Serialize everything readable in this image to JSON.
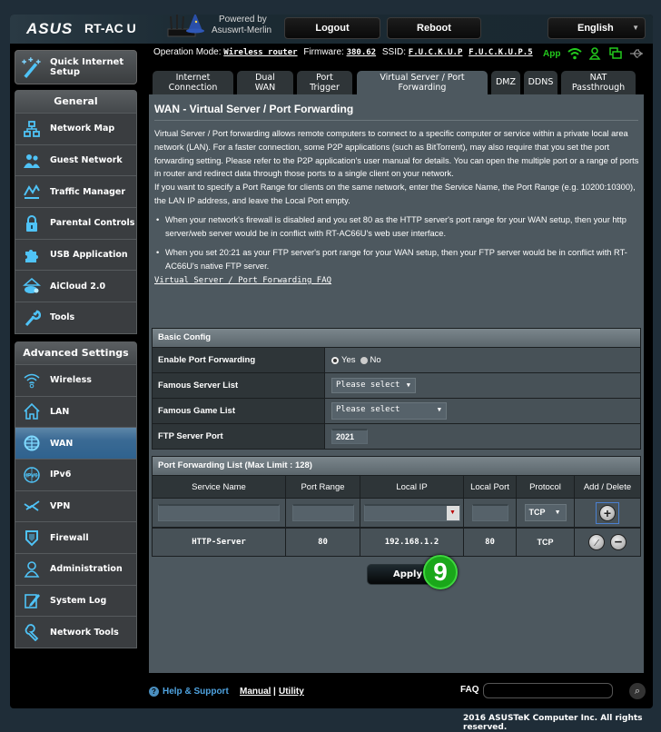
{
  "header": {
    "brand": "ASUS",
    "model": "RT-AC  U",
    "powered_by": "Powered by",
    "powered_by_name": "Asuswrt-Merlin",
    "logout_label": "Logout",
    "reboot_label": "Reboot",
    "language": "English"
  },
  "opbar": {
    "operation_mode_label": "Operation Mode:",
    "operation_mode_value": "Wireless router",
    "firmware_label": "Firmware:",
    "firmware_value": "380.62",
    "ssid_label": "SSID:",
    "ssid_24": "F.U.C.K.U.P",
    "ssid_5": "F.U.C.K.U.P.5",
    "app_label": "App"
  },
  "sidebar": {
    "quick_setup_line1": "Quick Internet",
    "quick_setup_line2": "Setup",
    "general_header": "General",
    "general_items": [
      {
        "label": "Network Map",
        "icon": "network-map-icon"
      },
      {
        "label": "Guest Network",
        "icon": "guest-network-icon"
      },
      {
        "label": "Traffic Manager",
        "icon": "traffic-manager-icon"
      },
      {
        "label": "Parental Controls",
        "icon": "lock-icon"
      },
      {
        "label": "USB Application",
        "icon": "puzzle-icon"
      },
      {
        "label": "AiCloud 2.0",
        "icon": "cloud-icon"
      },
      {
        "label": "Tools",
        "icon": "wrench-icon"
      }
    ],
    "advanced_header": "Advanced Settings",
    "advanced_items": [
      {
        "label": "Wireless",
        "icon": "wifi-icon"
      },
      {
        "label": "LAN",
        "icon": "home-icon"
      },
      {
        "label": "WAN",
        "icon": "globe-icon",
        "active": true
      },
      {
        "label": "IPv6",
        "icon": "ipv6-icon"
      },
      {
        "label": "VPN",
        "icon": "vpn-icon"
      },
      {
        "label": "Firewall",
        "icon": "shield-icon"
      },
      {
        "label": "Administration",
        "icon": "admin-user-icon"
      },
      {
        "label": "System Log",
        "icon": "log-edit-icon"
      },
      {
        "label": "Network Tools",
        "icon": "network-tools-icon"
      }
    ]
  },
  "tabs": [
    {
      "line1": "Internet",
      "line2": "Connection"
    },
    {
      "line1": "Dual",
      "line2": "WAN"
    },
    {
      "line1": "Port",
      "line2": "Trigger"
    },
    {
      "line1": "Virtual Server / Port",
      "line2": "Forwarding",
      "active": true
    },
    {
      "line1": "DMZ",
      "line2": ""
    },
    {
      "line1": "DDNS",
      "line2": ""
    },
    {
      "line1": "NAT",
      "line2": "Passthrough"
    }
  ],
  "page": {
    "title": "WAN - Virtual Server / Port Forwarding",
    "description_1": "Virtual Server / Port forwarding allows remote computers to connect to a specific computer or service within a private local area network (LAN). For a faster connection, some P2P applications (such as BitTorrent), may also require that you set the port forwarding setting. Please refer to the P2P application's user manual for details. You can open the multiple port or a range of ports in router and redirect data through those ports to a single client on your network.",
    "description_2": "If you want to specify a Port Range for clients on the same network, enter the Service Name, the Port Range (e.g. 10200:10300), the LAN IP address, and leave the Local Port empty.",
    "bullet_1": "When your network's firewall is disabled and you set 80 as the HTTP server's port range for your WAN setup, then your http server/web server would be in conflict with RT-AC66U's web user interface.",
    "bullet_2": "When you set 20:21 as your FTP server's port range for your WAN setup, then your FTP server would be in conflict with RT-AC66U's native FTP server.",
    "faq_link": "Virtual Server / Port Forwarding FAQ"
  },
  "basic_config": {
    "header": "Basic Config",
    "enable_label": "Enable Port Forwarding",
    "yes_label": "Yes",
    "no_label": "No",
    "enabled": "Yes",
    "server_list_label": "Famous Server List",
    "server_list_value": "Please select",
    "game_list_label": "Famous Game List",
    "game_list_value": "Please select",
    "ftp_port_label": "FTP Server Port",
    "ftp_port_value": "2021"
  },
  "pf_list": {
    "header": "Port Forwarding List (Max Limit : 128)",
    "columns": [
      "Service Name",
      "Port Range",
      "Local IP",
      "Local Port",
      "Protocol",
      "Add / Delete"
    ],
    "new_row": {
      "service_name": "",
      "port_range": "",
      "local_ip": "",
      "local_port": "",
      "protocol": "TCP"
    },
    "rows": [
      {
        "service_name": "HTTP-Server",
        "port_range": "80",
        "local_ip": "192.168.1.2",
        "local_port": "80",
        "protocol": "TCP"
      }
    ]
  },
  "apply_label": "Apply",
  "step_badge": "9",
  "footer": {
    "help": "Help & Support",
    "manual": "Manual",
    "separator": "|",
    "utility": "Utility",
    "faq_label": "FAQ",
    "faq_search_value": "",
    "copyright": "2016 ASUSTeK Computer Inc. All rights reserved."
  },
  "colors": {
    "accent_green": "#23c91d",
    "active_menu": "#3a6a94",
    "icon_blue": "#4fc3f7",
    "content_bg": "#4d585f"
  }
}
